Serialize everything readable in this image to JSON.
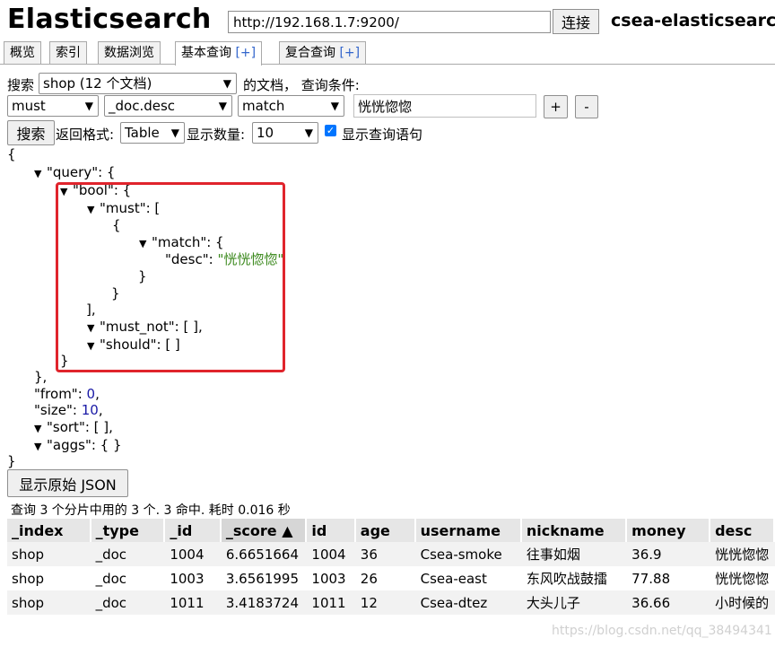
{
  "header": {
    "title": "Elasticsearch",
    "url": "http://192.168.1.7:9200/",
    "connect_label": "连接",
    "cluster_name": "csea-elasticsearch"
  },
  "tabs": [
    {
      "label": "概览"
    },
    {
      "label": "索引"
    },
    {
      "label": "数据浏览"
    },
    {
      "label": "基本查询",
      "plus": "[+]"
    },
    {
      "label": "复合查询",
      "plus": "[+]"
    }
  ],
  "query_builder": {
    "search_label": "搜索",
    "index_select": "shop (12 个文档)",
    "docs_label": "的文档，  查询条件:",
    "occur_select": "must",
    "field_select": "_doc.desc",
    "op_select": "match",
    "term_value": "恍恍惚惚",
    "add_label": "+",
    "remove_label": "-",
    "search_button": "搜索",
    "format_label": "返回格式:",
    "format_select": "Table",
    "size_label": "显示数量:",
    "size_select": "10",
    "show_query_label": "显示查询语句",
    "show_query_checked": true
  },
  "json_view": {
    "open_brace": "{",
    "query_key": "\"query\": {",
    "bool_key": "\"bool\": {",
    "must_key": "\"must\": [",
    "inner_open": "{",
    "match_key": "\"match\": {",
    "desc_key": "\"desc\": ",
    "desc_val": "\"恍恍惚惚\"",
    "match_close": "}",
    "inner_close": "}",
    "must_close": "],",
    "must_not": "\"must_not\": [ ],",
    "should": "\"should\": [ ]",
    "bool_close": "}",
    "query_close": "},",
    "from_key": "\"from\": ",
    "from_val": "0",
    "size_key": "\"size\": ",
    "size_val": "10",
    "comma": ",",
    "sort": "\"sort\": [ ],",
    "aggs": "\"aggs\": { }",
    "close_brace": "}"
  },
  "results": {
    "raw_json_button": "显示原始 JSON",
    "summary": "查询 3 个分片中用的 3 个. 3 命中. 耗时 0.016 秒",
    "columns": [
      "_index",
      "_type",
      "_id",
      "_score ▲",
      "id",
      "age",
      "username",
      "nickname",
      "money",
      "desc"
    ],
    "rows": [
      [
        "shop",
        "_doc",
        "1004",
        "6.6651664",
        "1004",
        "36",
        "Csea-smoke",
        "往事如烟",
        "36.9",
        "恍恍惚惚"
      ],
      [
        "shop",
        "_doc",
        "1003",
        "3.6561995",
        "1003",
        "26",
        "Csea-east",
        "东风吹战鼓擂",
        "77.88",
        "恍恍惚惚"
      ],
      [
        "shop",
        "_doc",
        "1011",
        "3.4183724",
        "1011",
        "12",
        "Csea-dtez",
        "大头儿子",
        "36.66",
        "小时候的"
      ]
    ]
  },
  "watermark": "https://blog.csdn.net/qq_38494341",
  "colors": {
    "highlight": "#e0242c",
    "number": "#1a1aa6",
    "string": "#3d8a1f",
    "checkbox": "#0075ff"
  }
}
